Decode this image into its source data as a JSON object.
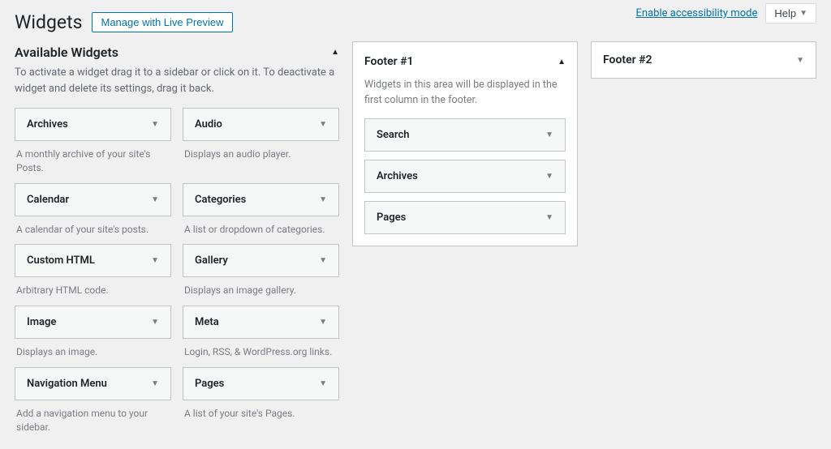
{
  "toolbar": {
    "accessibility": "Enable accessibility mode",
    "help": "Help"
  },
  "header": {
    "title": "Widgets",
    "preview_btn": "Manage with Live Preview"
  },
  "available": {
    "heading": "Available Widgets",
    "description": "To activate a widget drag it to a sidebar or click on it. To deactivate a widget and delete its settings, drag it back.",
    "items": [
      {
        "name": "Archives",
        "desc": "A monthly archive of your site's Posts."
      },
      {
        "name": "Audio",
        "desc": "Displays an audio player."
      },
      {
        "name": "Calendar",
        "desc": "A calendar of your site's posts."
      },
      {
        "name": "Categories",
        "desc": "A list or dropdown of categories."
      },
      {
        "name": "Custom HTML",
        "desc": "Arbitrary HTML code."
      },
      {
        "name": "Gallery",
        "desc": "Displays an image gallery."
      },
      {
        "name": "Image",
        "desc": "Displays an image."
      },
      {
        "name": "Meta",
        "desc": "Login, RSS, & WordPress.org links."
      },
      {
        "name": "Navigation Menu",
        "desc": "Add a navigation menu to your sidebar."
      },
      {
        "name": "Pages",
        "desc": "A list of your site's Pages."
      }
    ]
  },
  "areas": {
    "footer1": {
      "title": "Footer #1",
      "desc": "Widgets in this area will be displayed in the first column in the footer.",
      "widgets": [
        {
          "name": "Search"
        },
        {
          "name": "Archives"
        },
        {
          "name": "Pages"
        }
      ]
    },
    "footer2": {
      "title": "Footer #2"
    }
  }
}
